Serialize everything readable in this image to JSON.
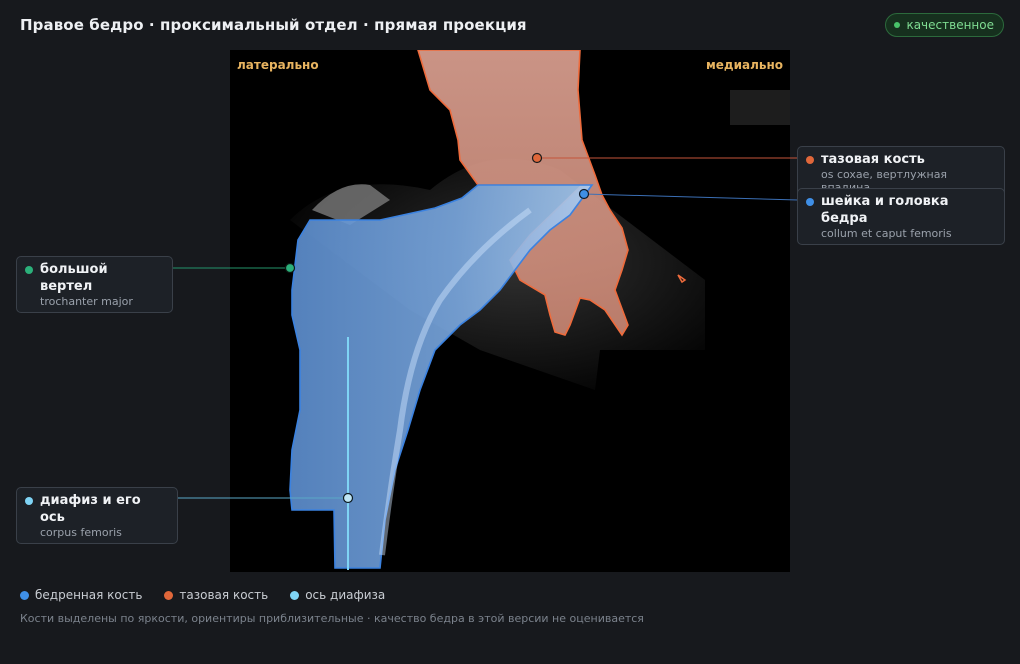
{
  "header": {
    "title": "Правое бедро · проксимальный отдел · прямая проекция",
    "badge_label": "качественное"
  },
  "viewer": {
    "left_label": "латерально",
    "right_label": "медиально"
  },
  "callouts": {
    "pelvis": {
      "label": "тазовая кость",
      "sublabel": "os coxae, вертлужная впадина",
      "color": "#e0673a"
    },
    "neck": {
      "label": "шейка и головка бедра",
      "sublabel": "collum et caput femoris",
      "color": "#3f8fe6"
    },
    "trochanter": {
      "label": "большой вертел",
      "sublabel": "trochanter major",
      "color": "#2bb07a"
    },
    "shaft": {
      "label": "диафиз и его ось",
      "sublabel": "corpus femoris",
      "color": "#7fd4f5"
    }
  },
  "legend": {
    "femur": {
      "label": "бедренная кость",
      "color": "#3f8fe6"
    },
    "pelvis": {
      "label": "тазовая кость",
      "color": "#e0673a"
    },
    "axis": {
      "label": "ось диафиза",
      "color": "#7fd4f5"
    }
  },
  "footnote": "Кости выделены по яркости, ориентиры приблизительные · качество бедра в этой версии не оценивается"
}
